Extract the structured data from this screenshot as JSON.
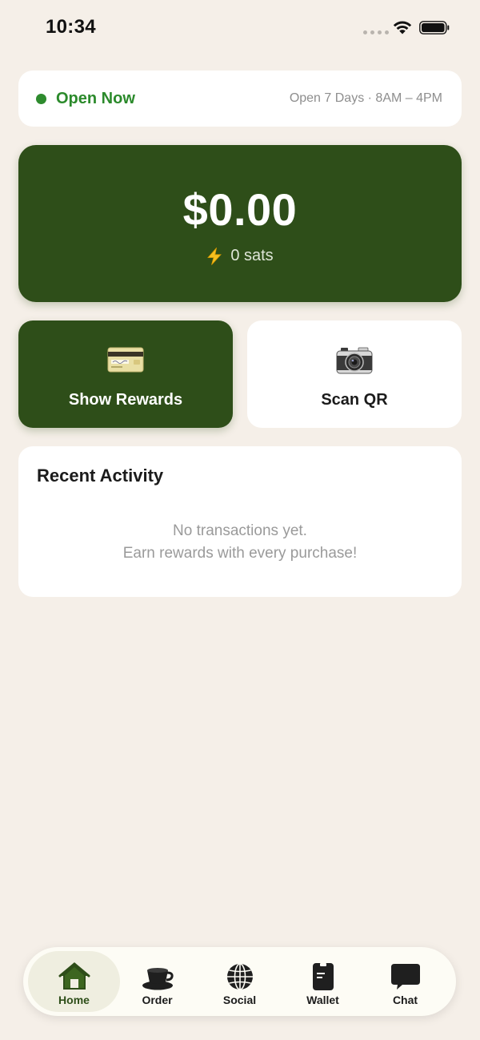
{
  "status_bar": {
    "time": "10:34"
  },
  "hours": {
    "status": "Open Now",
    "schedule": "Open 7 Days · 8AM – 4PM",
    "status_color": "#2b8a2b"
  },
  "balance": {
    "amount": "$0.00",
    "sats": "0 sats",
    "card_color": "#2e4e19"
  },
  "actions": {
    "rewards": {
      "label": "Show Rewards",
      "icon": "credit-card-icon"
    },
    "scan": {
      "label": "Scan QR",
      "icon": "camera-icon"
    }
  },
  "activity": {
    "title": "Recent Activity",
    "empty_line1": "No transactions yet.",
    "empty_line2": "Earn rewards with every purchase!"
  },
  "tabs": [
    {
      "label": "Home",
      "icon": "home-icon",
      "active": true
    },
    {
      "label": "Order",
      "icon": "coffee-cup-icon",
      "active": false
    },
    {
      "label": "Social",
      "icon": "globe-icon",
      "active": false
    },
    {
      "label": "Wallet",
      "icon": "wallet-icon",
      "active": false
    },
    {
      "label": "Chat",
      "icon": "chat-bubble-icon",
      "active": false
    }
  ],
  "colors": {
    "background": "#f5efe8",
    "accent": "#2e4e19"
  }
}
